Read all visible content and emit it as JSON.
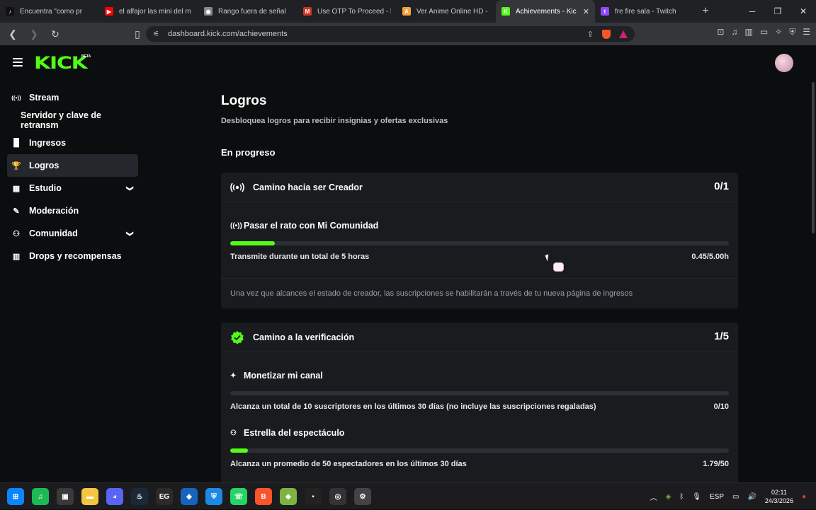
{
  "browser": {
    "tabs": [
      {
        "title": "Encuentra \"como pr",
        "fav_color": "#111111",
        "fav_glyph": "♪",
        "active": false
      },
      {
        "title": "el alfajor las mini del m",
        "fav_color": "#ff0000",
        "fav_glyph": "▶",
        "active": false
      },
      {
        "title": "Rango fuera de señal",
        "fav_color": "#888888",
        "fav_glyph": "◉",
        "active": false
      },
      {
        "title": "Use OTP To Proceed - b",
        "fav_color": "#d93025",
        "fav_glyph": "M",
        "active": false
      },
      {
        "title": "Ver Anime Online HD -",
        "fav_color": "#f2a33a",
        "fav_glyph": "A",
        "active": false
      },
      {
        "title": "Achievements - Kic",
        "fav_color": "#53fc18",
        "fav_glyph": "K",
        "active": true
      },
      {
        "title": "fre fire sala - Twitch",
        "fav_color": "#9146ff",
        "fav_glyph": "t",
        "active": false
      }
    ],
    "url": "dashboard.kick.com/achievements"
  },
  "header": {
    "logo": "KICK",
    "logo_badge": "BETA",
    "logo_color": "#53fc18"
  },
  "sidebar": {
    "items": [
      {
        "label": "Stream",
        "icon": "broadcast-icon",
        "glyph": "((•))",
        "active": false,
        "sub": false,
        "chevron": false
      },
      {
        "label": "Servidor y clave de retransm",
        "icon": "",
        "glyph": "",
        "active": false,
        "sub": true,
        "chevron": false
      },
      {
        "label": "Ingresos",
        "icon": "bar-chart-icon",
        "glyph": "▐▌",
        "active": false,
        "sub": false,
        "chevron": false
      },
      {
        "label": "Logros",
        "icon": "trophy-icon",
        "glyph": "🏆",
        "active": true,
        "sub": false,
        "chevron": false
      },
      {
        "label": "Estudio",
        "icon": "studio-icon",
        "glyph": "▦",
        "active": false,
        "sub": false,
        "chevron": true
      },
      {
        "label": "Moderación",
        "icon": "wrench-icon",
        "glyph": "✎",
        "active": false,
        "sub": false,
        "chevron": false
      },
      {
        "label": "Comunidad",
        "icon": "users-icon",
        "glyph": "⚇",
        "active": false,
        "sub": false,
        "chevron": true
      },
      {
        "label": "Drops y recompensas",
        "icon": "drops-icon",
        "glyph": "▥",
        "active": false,
        "sub": false,
        "chevron": false
      }
    ]
  },
  "main": {
    "title": "Logros",
    "subtitle": "Desbloquea logros para recibir insignias y ofertas exclusivas",
    "section_title": "En progreso",
    "cards": [
      {
        "title": "Camino hacia ser Creador",
        "count": "0/1",
        "tasks": [
          {
            "title": "Pasar el rato con Mi Comunidad",
            "description": "Transmite durante un total de 5 horas",
            "value": "0.45/5.00h",
            "progress": 0.09
          }
        ],
        "note": "Una vez que alcances el estado de creador, las suscripciones se habilitarán a través de tu nueva página de ingresos"
      },
      {
        "title": "Camino a la verificación",
        "count": "1/5",
        "tasks": [
          {
            "title": "Monetizar mi canal",
            "description": "Alcanza un total de 10 suscriptores en los últimos 30 días (no incluye las suscripciones regaladas)",
            "value": "0/10",
            "progress": 0.0
          },
          {
            "title": "Estrella del espectáculo",
            "description": "Alcanza un promedio de 50 espectadores en los últimos 30 días",
            "value": "1.79/50",
            "progress": 0.036
          }
        ]
      }
    ]
  },
  "taskbar": {
    "apps": [
      {
        "name": "windows-start-icon",
        "color": "#0a84ff",
        "glyph": "⊞"
      },
      {
        "name": "spotify-icon",
        "color": "#1db954",
        "glyph": "♫"
      },
      {
        "name": "store-icon",
        "color": "#3a3a3a",
        "glyph": "▣"
      },
      {
        "name": "file-explorer-icon",
        "color": "#f4c542",
        "glyph": "▬"
      },
      {
        "name": "discord-icon",
        "color": "#5865f2",
        "glyph": "◕"
      },
      {
        "name": "steam-icon",
        "color": "#1b2838",
        "glyph": "♨"
      },
      {
        "name": "epic-games-icon",
        "color": "#2a2a2a",
        "glyph": "EG"
      },
      {
        "name": "app-icon-blue",
        "color": "#1565c0",
        "glyph": "◆"
      },
      {
        "name": "shield-app-icon",
        "color": "#1e88e5",
        "glyph": "⛨"
      },
      {
        "name": "whatsapp-icon",
        "color": "#25d366",
        "glyph": "☏"
      },
      {
        "name": "brave-icon",
        "color": "#fb542b",
        "glyph": "B"
      },
      {
        "name": "bluestacks-icon",
        "color": "#7cb342",
        "glyph": "◈"
      },
      {
        "name": "app-icon-dark",
        "color": "#222222",
        "glyph": "▪"
      },
      {
        "name": "obs-icon",
        "color": "#333333",
        "glyph": "◎"
      },
      {
        "name": "settings-icon",
        "color": "#444444",
        "glyph": "⚙"
      }
    ],
    "language": "ESP",
    "time": "02:11",
    "date": "24/3/2026"
  }
}
